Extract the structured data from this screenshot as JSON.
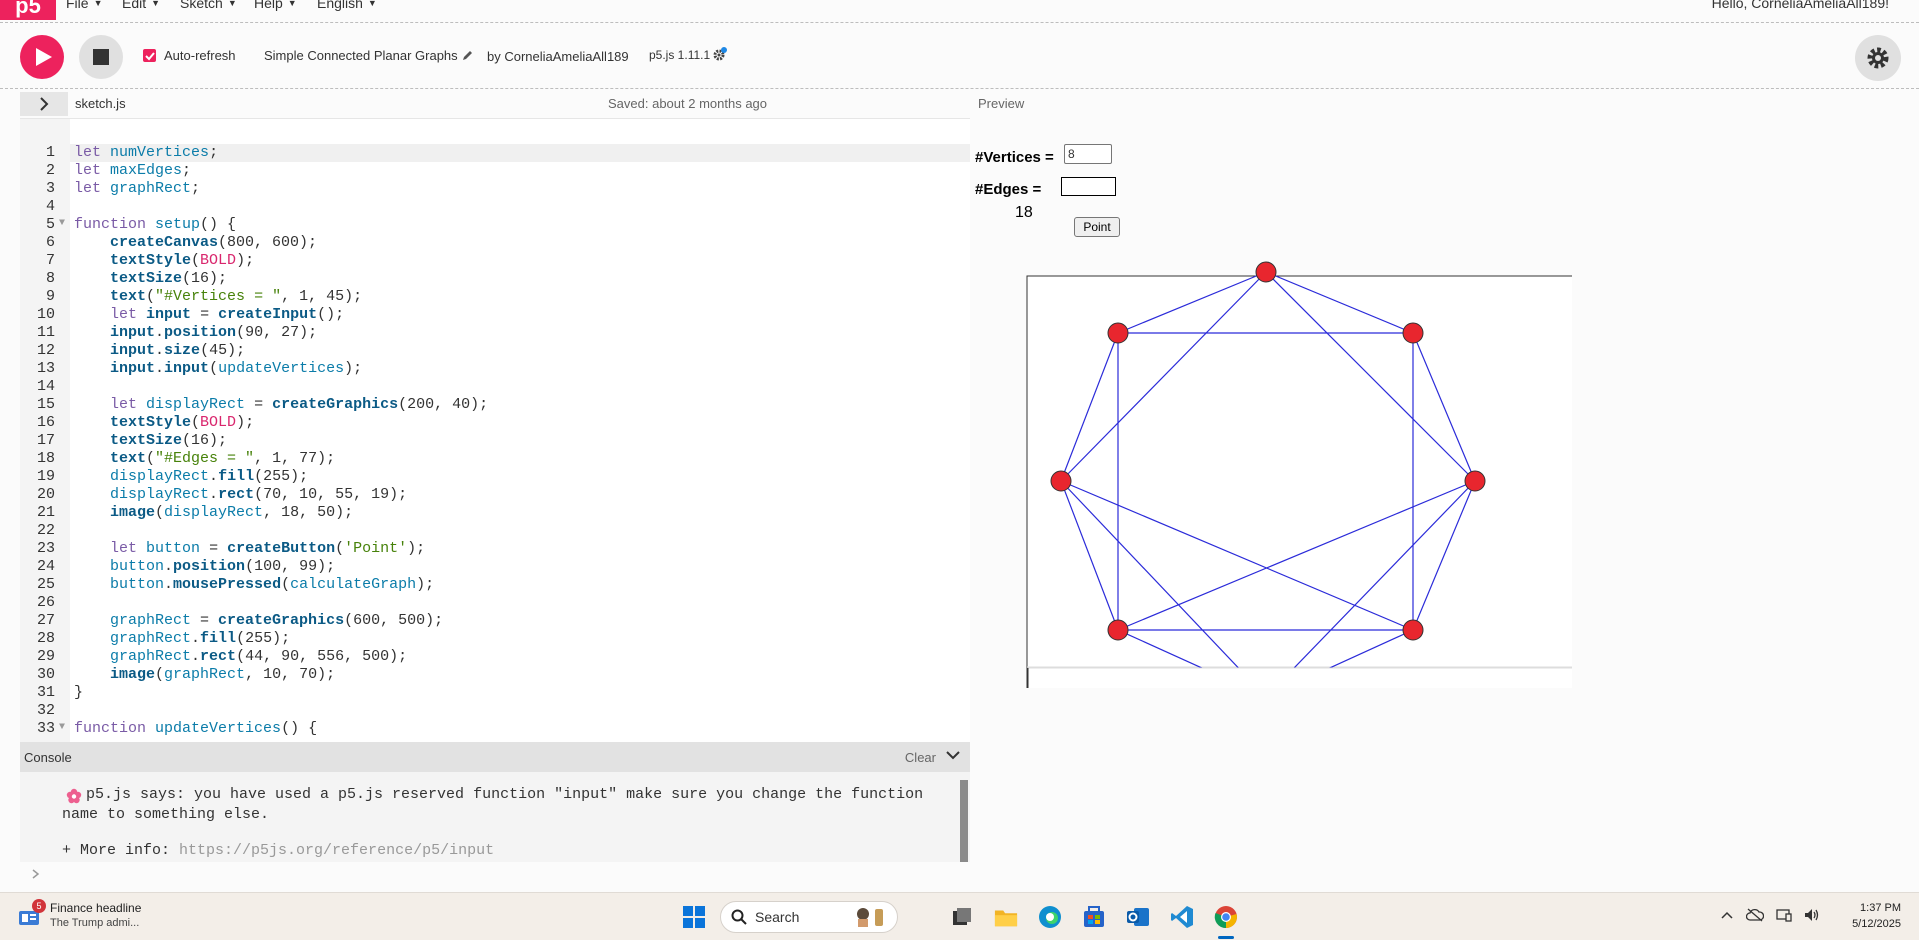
{
  "nav": {
    "logo": "p5",
    "menus": [
      "File",
      "Edit",
      "Sketch",
      "Help",
      "English"
    ],
    "greeting": "Hello, CorneliaAmeliaAll189!"
  },
  "toolbar": {
    "auto_refresh_label": "Auto-refresh",
    "auto_refresh_checked": true,
    "project_name": "Simple Connected Planar Graphs",
    "by": "by CorneliaAmeliaAll189",
    "version": "p5.js 1.11.1"
  },
  "editor": {
    "file_name": "sketch.js",
    "saved_status": "Saved: about 2 months ago",
    "preview_label": "Preview",
    "lines": [
      "let numVertices;",
      "let maxEdges;",
      "let graphRect;",
      "",
      "function setup() {",
      "    createCanvas(800, 600);",
      "    textStyle(BOLD);",
      "    textSize(16);",
      "    text(\"#Vertices = \", 1, 45);",
      "    let input = createInput();",
      "    input.position(90, 27);",
      "    input.size(45);",
      "    input.input(updateVertices);",
      "",
      "    let displayRect = createGraphics(200, 40);",
      "    textStyle(BOLD);",
      "    textSize(16);",
      "    text(\"#Edges = \", 1, 77);",
      "    displayRect.fill(255);",
      "    displayRect.rect(70, 10, 55, 19);",
      "    image(displayRect, 18, 50);",
      "",
      "    let button = createButton('Point');",
      "    button.position(100, 99);",
      "    button.mousePressed(calculateGraph);",
      "",
      "    graphRect = createGraphics(600, 500);",
      "    graphRect.fill(255);",
      "    graphRect.rect(44, 90, 556, 500);",
      "    image(graphRect, 10, 70);",
      "}",
      "",
      "function updateVertices() {"
    ]
  },
  "console": {
    "title": "Console",
    "clear_label": "Clear",
    "message": "p5.js says: you have used a p5.js reserved function \"input\" make sure you change the function name to something else.",
    "more_info_label": "+ More info: ",
    "more_info_link": "https://p5js.org/reference/p5/input"
  },
  "preview": {
    "vertices_label": "#Vertices =",
    "vertices_value": "8",
    "edges_label": "#Edges =",
    "edges_value": "18",
    "button_label": "Point",
    "graph": {
      "vertex_color": "#e8262e",
      "edge_color": "#2b2bd9",
      "vertex_count": 8
    }
  },
  "taskbar": {
    "news_badge": "5",
    "news_title": "Finance headline",
    "news_sub": "The Trump admi...",
    "search_label": "Search",
    "time": "1:37 PM",
    "date": "5/12/2025"
  }
}
